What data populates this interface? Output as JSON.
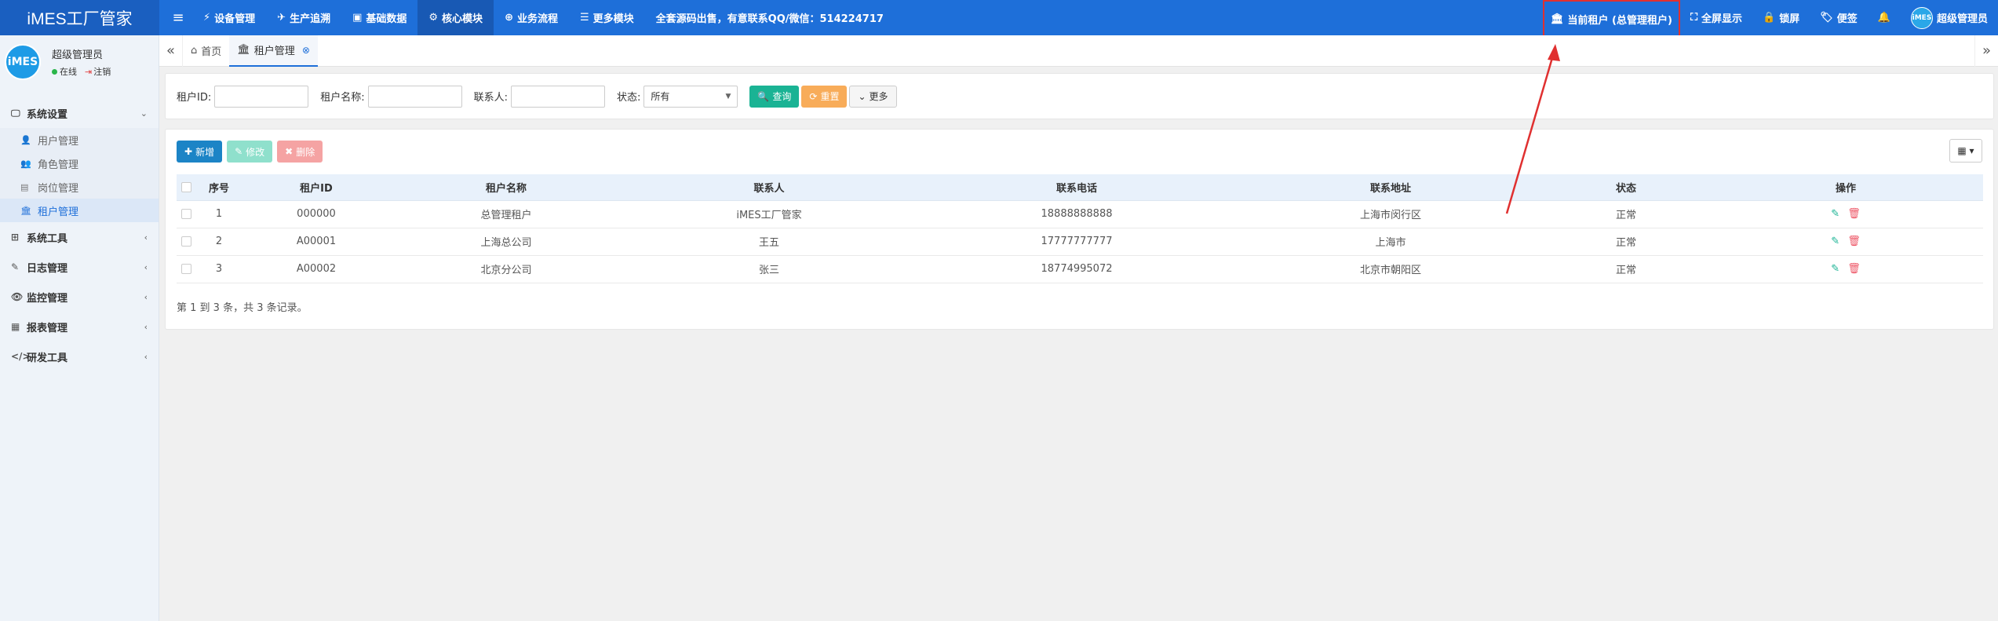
{
  "app": {
    "logo": "iMES工厂管家"
  },
  "topnav": {
    "items": [
      {
        "icon": "⚡",
        "label": "设备管理"
      },
      {
        "icon": "✈",
        "label": "生产追溯"
      },
      {
        "icon": "▣",
        "label": "基础数据"
      },
      {
        "icon": "⚙",
        "label": "核心模块"
      },
      {
        "icon": "⊕",
        "label": "业务流程"
      },
      {
        "icon": "☰",
        "label": "更多模块"
      }
    ],
    "notice": "全套源码出售，有意联系QQ/微信：514224717"
  },
  "topright": {
    "tenant": "当前租户 (总管理租户)",
    "fullscreen": "全屏显示",
    "lock": "锁屏",
    "notes": "便签",
    "user": "超级管理员",
    "avatar_text": "iMES"
  },
  "sidebar": {
    "user_name": "超级管理员",
    "online": "在线",
    "logout": "注销",
    "avatar_text": "iMES",
    "menus": [
      {
        "label": "系统设置",
        "icon": "🖵",
        "open": true,
        "children": [
          {
            "label": "用户管理",
            "icon": "👤"
          },
          {
            "label": "角色管理",
            "icon": "👥"
          },
          {
            "label": "岗位管理",
            "icon": "▤"
          },
          {
            "label": "租户管理",
            "icon": "🏛"
          }
        ]
      },
      {
        "label": "系统工具",
        "icon": "⊞"
      },
      {
        "label": "日志管理",
        "icon": "✎"
      },
      {
        "label": "监控管理",
        "icon": "👁"
      },
      {
        "label": "报表管理",
        "icon": "▦"
      },
      {
        "label": "研发工具",
        "icon": "</>"
      }
    ]
  },
  "tabs": {
    "home": "首页",
    "current": "租户管理"
  },
  "search": {
    "tenant_id_label": "租户ID:",
    "tenant_name_label": "租户名称:",
    "contact_label": "联系人:",
    "status_label": "状态:",
    "status_value": "所有",
    "query": "查询",
    "reset": "重置",
    "more": "更多"
  },
  "toolbar": {
    "add": "新增",
    "edit": "修改",
    "delete": "删除"
  },
  "table": {
    "headers": [
      "序号",
      "租户ID",
      "租户名称",
      "联系人",
      "联系电话",
      "联系地址",
      "状态",
      "操作"
    ],
    "rows": [
      [
        "1",
        "000000",
        "总管理租户",
        "iMES工厂管家",
        "18888888888",
        "上海市闵行区",
        "正常"
      ],
      [
        "2",
        "A00001",
        "上海总公司",
        "王五",
        "17777777777",
        "上海市",
        "正常"
      ],
      [
        "3",
        "A00002",
        "北京分公司",
        "张三",
        "18774995072",
        "北京市朝阳区",
        "正常"
      ]
    ]
  },
  "pager": {
    "text": "第 1 到 3 条，共 3 条记录。"
  },
  "colors": {
    "primary": "#1e6fd9",
    "annotation": "#e03030",
    "success": "#1ab394",
    "danger": "#ed5565"
  }
}
